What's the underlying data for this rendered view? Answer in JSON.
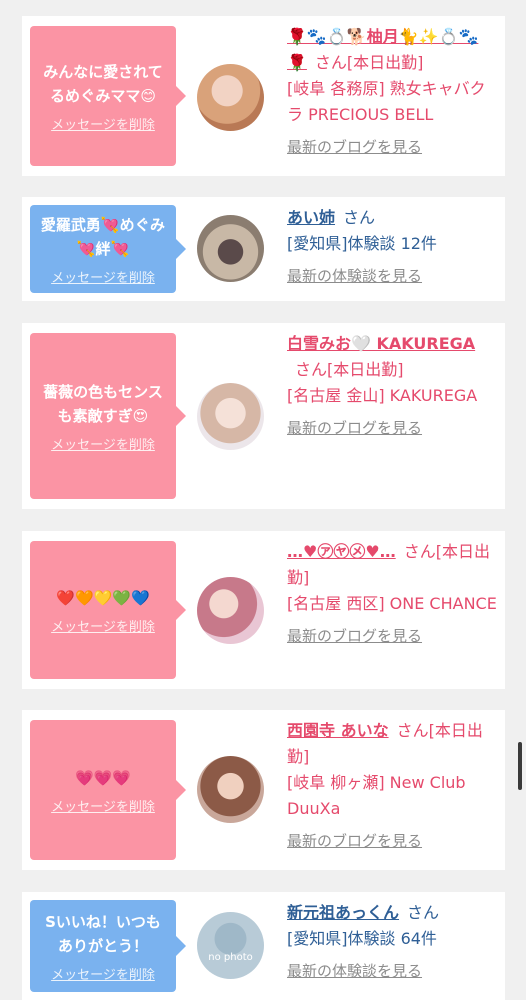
{
  "cards": [
    {
      "message": "みんなに愛されて\nるめぐみママ😊",
      "delete_label": "メッセージを削除",
      "name": "🌹🐾💍🐕柚月🐈✨💍🐾🌹",
      "honorific": "さん[本日出勤]",
      "meta": "[岐阜 各務原] 熟女キャバクラ PRECIOUS BELL",
      "link": "最新のブログを見る",
      "bubble_color": "#fb94a4"
    },
    {
      "message": "愛羅武勇💘めぐみ\n💘絆💘",
      "delete_label": "メッセージを削除",
      "name": "あい姉",
      "honorific": "さん",
      "meta": "[愛知県]体験談 12件",
      "link": "最新の体験談を見る",
      "bubble_color": "#7ab2ef"
    },
    {
      "message": "薔薇の色もセンス\nも素敵すぎ😍",
      "delete_label": "メッセージを削除",
      "name": "白雪みお🤍 KAKUREGA",
      "honorific": "さん[本日出勤]",
      "meta": "[名古屋 金山] KAKUREGA",
      "link": "最新のブログを見る",
      "bubble_color": "#fb94a4"
    },
    {
      "message": "❤️🧡💛💚💙",
      "delete_label": "メッセージを削除",
      "name": "…♥㋐㋳㋱♥…",
      "honorific": "さん[本日出勤]",
      "meta": "[名古屋 西区] ONE CHANCE",
      "link": "最新のブログを見る",
      "bubble_color": "#fb94a4"
    },
    {
      "message": "💗💗💗",
      "delete_label": "メッセージを削除",
      "name": "西園寺 あいな",
      "honorific": "さん[本日出勤]",
      "meta": "[岐阜 柳ヶ瀬] New Club DuuXa",
      "link": "最新のブログを見る",
      "bubble_color": "#fb94a4"
    },
    {
      "message": "Sいいね！いつも\nありがとう！",
      "delete_label": "メッセージを削除",
      "name": "新元祖あっくん",
      "honorific": "さん",
      "meta": "[愛知県]体験談 64件",
      "link": "最新の体験談を見る",
      "avatar_text": "no photo",
      "bubble_color": "#7ab2ef"
    }
  ]
}
